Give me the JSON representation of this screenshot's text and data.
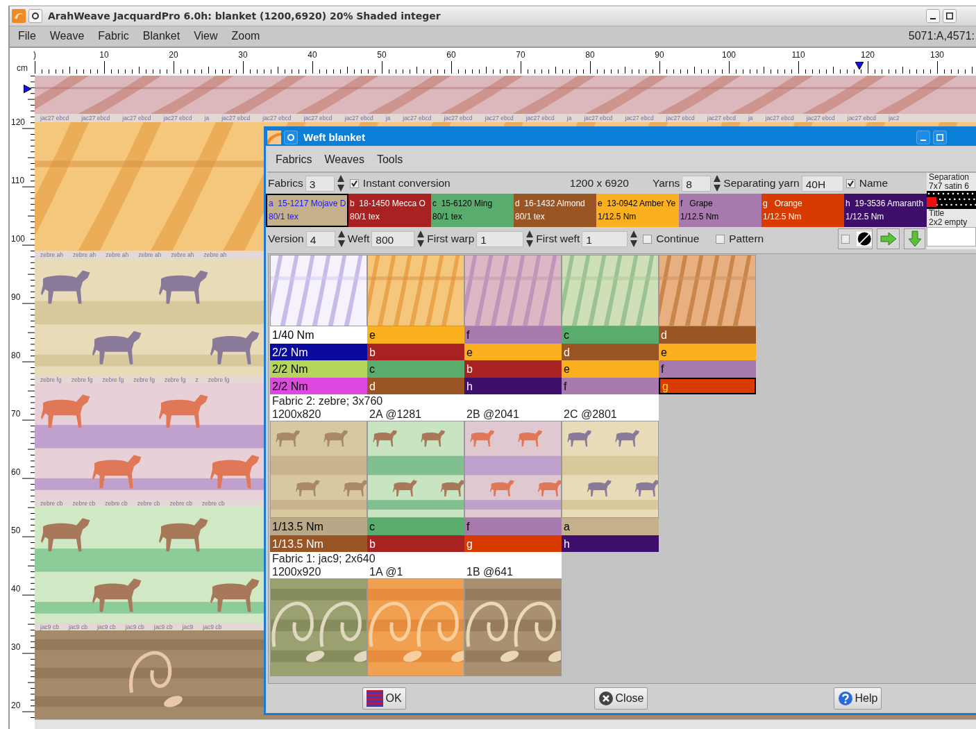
{
  "window": {
    "title": "ArahWeave JacquardPro 6.0h: blanket (1200,6920) 20% Shaded integer"
  },
  "menu": [
    "File",
    "Weave",
    "Fabric",
    "Blanket",
    "View",
    "Zoom"
  ],
  "status": "5071:A,4571:",
  "ruler": {
    "unit": "cm",
    "top_labels": [
      ")",
      "10",
      "20",
      "30",
      "40",
      "50",
      "60",
      "70",
      "80",
      "90",
      "100",
      "110",
      "120",
      "130"
    ],
    "left_labels": [
      "120",
      "110",
      "100",
      "90",
      "80",
      "70",
      "60",
      "50",
      "40",
      "30",
      "20"
    ]
  },
  "canvas": {
    "bands": [
      {
        "kind": "picture",
        "labels": [
          "jac27 ebcd",
          "jac27 ebcd",
          "jac27 ebcd",
          "jac27 ebcd",
          "ja",
          "jac27 ebcd",
          "jac27 ebcd",
          "jac27 ebcd",
          "jac27 ebcd",
          "ja",
          "jac27 ebcd",
          "jac27 ebcd",
          "jac27 ebcd",
          "jac27 ebcd",
          "ja",
          "jac27 ebcd",
          "jac27 ebcd",
          "jac27 ebcd",
          "jac27 ebcd",
          "ja",
          "jac27 ebcd",
          "jac27 ebcd",
          "jac27 ebcd",
          "jac2"
        ]
      },
      {
        "kind": "picture",
        "labels": [
          "zebre ah",
          "zebre ah",
          "zebre ah",
          "zebre ah",
          "zebre ah",
          "zebre ah"
        ]
      },
      {
        "kind": "picture",
        "labels": [
          "zebre fg",
          "zebre fg",
          "zebre fg",
          "zebre fg",
          "zebre fg",
          "z",
          "zebre fg"
        ]
      },
      {
        "kind": "picture",
        "labels": [
          "zebre cb",
          "zebre cb",
          "zebre cb",
          "zebre cb",
          "zebre cb",
          "zebre cb"
        ]
      },
      {
        "kind": "picture",
        "labels": [
          "jac9 cb",
          "jac9 cb",
          "jac9 cb",
          "jac9 cb",
          "jac9 cb",
          "jac9",
          "jac9 cb"
        ]
      },
      {
        "kind": "picture"
      }
    ]
  },
  "dialog": {
    "title": "Weft blanket",
    "menu": [
      "Fabrics",
      "Weaves",
      "Tools"
    ],
    "fabrics": {
      "label": "Fabrics",
      "value": "3"
    },
    "instant_conversion": {
      "label": "Instant conversion",
      "checked": true
    },
    "size": "1200 x 6920",
    "yarns": {
      "label": "Yarns",
      "value": "8"
    },
    "separating_yarn": {
      "label": "Separating yarn",
      "value": "40H"
    },
    "name": {
      "label": "Name",
      "checked": true
    },
    "yarn_list": [
      {
        "line1": "a  15-1217 Mojave D",
        "line2": "80/1 tex",
        "color": "#c4b08a",
        "selected": true
      },
      {
        "line1": "b  18-1450 Mecca O",
        "line2": "80/1 tex",
        "color": "#a82222",
        "selected": false
      },
      {
        "line1": "c  15-6120 Ming",
        "line2": "80/1 tex",
        "color": "#5aac6e",
        "selected": false
      },
      {
        "line1": "d  16-1432 Almond",
        "line2": "80/1 tex",
        "color": "#9a5525",
        "selected": false
      },
      {
        "line1": "e  13-0942 Amber Ye",
        "line2": "1/12.5 Nm",
        "color": "#fbb020",
        "selected": false
      },
      {
        "line1": "f   Grape",
        "line2": "1/12.5 Nm",
        "color": "#a879ac",
        "selected": false
      },
      {
        "line1": "g   Orange",
        "line2": "1/12.5 Nm",
        "color": "#d83a00",
        "selected": false
      },
      {
        "line1": "h  19-3536 Amaranth",
        "line2": "1/12.5 Nm",
        "color": "#3e0f6a",
        "selected": false
      }
    ],
    "separation": {
      "label": "Separation",
      "weave": "7x7 satin 6"
    },
    "title_weave": {
      "label": "Title",
      "weave": "2x2 empty"
    },
    "version": {
      "label": "Version",
      "value": "4"
    },
    "weft": {
      "label": "Weft",
      "value": "800"
    },
    "first_warp": {
      "label": "First warp",
      "value": "1"
    },
    "first_weft": {
      "label": "First weft",
      "value": "1"
    },
    "continue": {
      "label": "Continue",
      "checked": false
    },
    "pattern": {
      "label": "Pattern",
      "checked": false
    },
    "mask_toggle": {
      "checked": false
    },
    "blocks": [
      {
        "thumbnails": [
          {
            "kind": "picture"
          },
          {
            "kind": "picture"
          },
          {
            "kind": "picture"
          },
          {
            "kind": "picture"
          },
          {
            "kind": "picture"
          }
        ],
        "yarn_rows": [
          [
            {
              "text": "1/40 Nm",
              "color": "#ffffff",
              "selected": false
            },
            {
              "text": "e",
              "color": "#fbb020",
              "selected": false
            },
            {
              "text": "f",
              "color": "#a879ac",
              "selected": false
            },
            {
              "text": "c",
              "color": "#5aac6e",
              "selected": false
            },
            {
              "text": "d",
              "color": "#9a5525",
              "selected": false
            }
          ],
          [
            {
              "text": "2/2 Nm",
              "color": "#0a0aa0",
              "selected": false
            },
            {
              "text": "b",
              "color": "#a82222",
              "selected": false
            },
            {
              "text": "e",
              "color": "#fbb020",
              "selected": false
            },
            {
              "text": "d",
              "color": "#9a5525",
              "selected": false
            },
            {
              "text": "e",
              "color": "#fbb020",
              "selected": false
            }
          ],
          [
            {
              "text": "2/2 Nm",
              "color": "#b4d45a",
              "selected": false
            },
            {
              "text": "c",
              "color": "#5aac6e",
              "selected": false
            },
            {
              "text": "b",
              "color": "#a82222",
              "selected": false
            },
            {
              "text": "e",
              "color": "#fbb020",
              "selected": false
            },
            {
              "text": "f",
              "color": "#a879ac",
              "selected": false
            }
          ],
          [
            {
              "text": "2/2 Nm",
              "color": "#dc48e0",
              "selected": false
            },
            {
              "text": "d",
              "color": "#9a5525",
              "selected": false
            },
            {
              "text": "h",
              "color": "#3e0f6a",
              "selected": false
            },
            {
              "text": "f",
              "color": "#a879ac",
              "selected": false
            },
            {
              "text": "g",
              "color": "#d83a00",
              "selected": true
            }
          ]
        ]
      },
      {
        "title": "Fabric 2: zebre; 3x760",
        "size": "1200x820",
        "starts": [
          "2A @1281",
          "2B @2041",
          "2C @2801"
        ],
        "thumbnails": [
          {
            "kind": "picture"
          },
          {
            "kind": "picture"
          },
          {
            "kind": "picture"
          },
          {
            "kind": "picture"
          }
        ],
        "yarn_rows": [
          [
            {
              "text": "1/13.5 Nm",
              "color": "#b8a888",
              "selected": false
            },
            {
              "text": "c",
              "color": "#5aac6e",
              "selected": false
            },
            {
              "text": "f",
              "color": "#a879ac",
              "selected": false
            },
            {
              "text": "a",
              "color": "#c4b08a",
              "selected": false
            }
          ],
          [
            {
              "text": "1/13.5 Nm",
              "color": "#9a5525",
              "selected": false
            },
            {
              "text": "b",
              "color": "#a82222",
              "selected": false
            },
            {
              "text": "g",
              "color": "#d83a00",
              "selected": false
            },
            {
              "text": "h",
              "color": "#3e0f6a",
              "selected": false
            }
          ]
        ]
      },
      {
        "title": "Fabric 1: jac9; 2x640",
        "size": "1200x920",
        "starts": [
          "1A @1",
          "1B @641"
        ],
        "thumbnails": [
          {
            "kind": "picture"
          },
          {
            "kind": "picture"
          },
          {
            "kind": "picture"
          }
        ]
      }
    ],
    "buttons": [
      {
        "kind": "ok",
        "label": "OK"
      },
      {
        "kind": "close",
        "label": "Close"
      },
      {
        "kind": "help",
        "label": "Help"
      }
    ]
  }
}
